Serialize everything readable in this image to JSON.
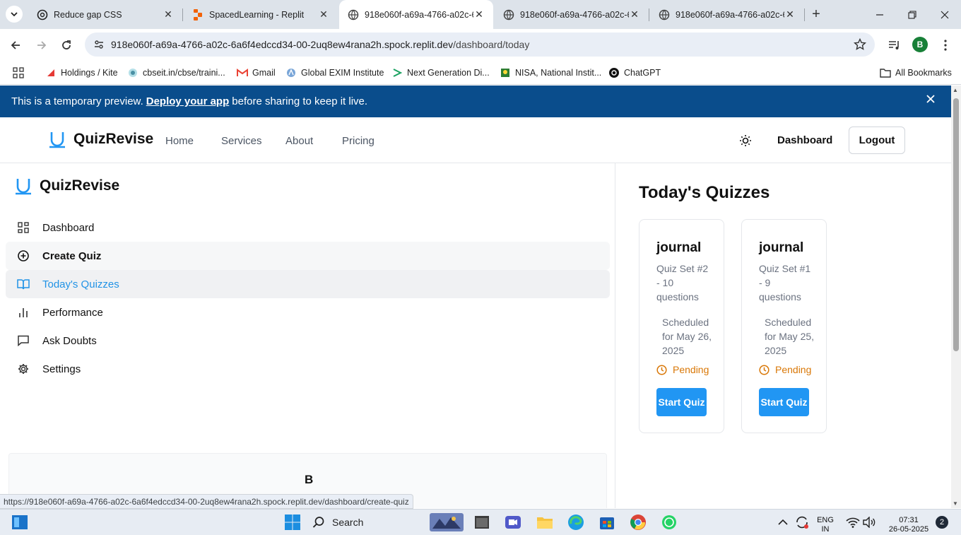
{
  "browser": {
    "tabs": [
      {
        "title": "Reduce gap CSS",
        "icon": "chatgpt-icon",
        "active": false
      },
      {
        "title": "SpacedLearning - Replit",
        "icon": "replit-icon",
        "active": false
      },
      {
        "title": "918e060f-a69a-4766-a02c-6",
        "icon": "globe-icon",
        "active": true
      },
      {
        "title": "918e060f-a69a-4766-a02c-6",
        "icon": "globe-icon",
        "active": false
      },
      {
        "title": "918e060f-a69a-4766-a02c-6",
        "icon": "globe-icon",
        "active": false
      }
    ],
    "url_host": "918e060f-a69a-4766-a02c-6a6f4edccd34-00-2uq8ew4rana2h.spock.replit.dev",
    "url_path": "/dashboard/today",
    "profile_initial": "B",
    "bookmarks": [
      {
        "label": "Holdings / Kite",
        "icon": "kite-icon"
      },
      {
        "label": "cbseit.in/cbse/traini...",
        "icon": "cbse-icon"
      },
      {
        "label": "Gmail",
        "icon": "gmail-icon"
      },
      {
        "label": "Global EXIM Institute",
        "icon": "exim-icon"
      },
      {
        "label": "Next Generation Di...",
        "icon": "arrow-icon"
      },
      {
        "label": "NISA, National Instit...",
        "icon": "nisa-icon"
      },
      {
        "label": "ChatGPT",
        "icon": "chatgpt-icon"
      }
    ],
    "all_bookmarks": "All Bookmarks",
    "status_url": "https://918e060f-a69a-4766-a02c-6a6f4edccd34-00-2uq8ew4rana2h.spock.replit.dev/dashboard/create-quiz"
  },
  "banner": {
    "prefix": "This is a temporary preview.",
    "link": "Deploy your app",
    "suffix": "before sharing to keep it live."
  },
  "header": {
    "brand": "QuizRevise",
    "nav": [
      "Home",
      "Services",
      "About",
      "Pricing"
    ],
    "dashboard": "Dashboard",
    "logout": "Logout"
  },
  "sidebar": {
    "brand": "QuizRevise",
    "items": [
      {
        "label": "Dashboard",
        "icon": "grid-icon"
      },
      {
        "label": "Create Quiz",
        "icon": "plus-circle-icon"
      },
      {
        "label": "Today's Quizzes",
        "icon": "book-open-icon"
      },
      {
        "label": "Performance",
        "icon": "bar-chart-icon"
      },
      {
        "label": "Ask Doubts",
        "icon": "message-square-icon"
      },
      {
        "label": "Settings",
        "icon": "gear-icon"
      }
    ],
    "user_initial": "B"
  },
  "main": {
    "title": "Today's Quizzes",
    "quizzes": [
      {
        "title": "journal",
        "subtitle": "Quiz Set #2 - 10 questions",
        "scheduled": "Scheduled for May 26, 2025",
        "status": "Pending",
        "button": "Start Quiz"
      },
      {
        "title": "journal",
        "subtitle": "Quiz Set #1 - 9 questions",
        "scheduled": "Scheduled for May 25, 2025",
        "status": "Pending",
        "button": "Start Quiz"
      }
    ]
  },
  "taskbar": {
    "search": "Search",
    "lang_top": "ENG",
    "lang_bottom": "IN",
    "time": "07:31",
    "date": "26-05-2025",
    "notifications": "2"
  },
  "colors": {
    "banner": "#0a4d8c",
    "accent": "#2196f3",
    "pending": "#d97706",
    "active_nav": "#2193e6"
  }
}
